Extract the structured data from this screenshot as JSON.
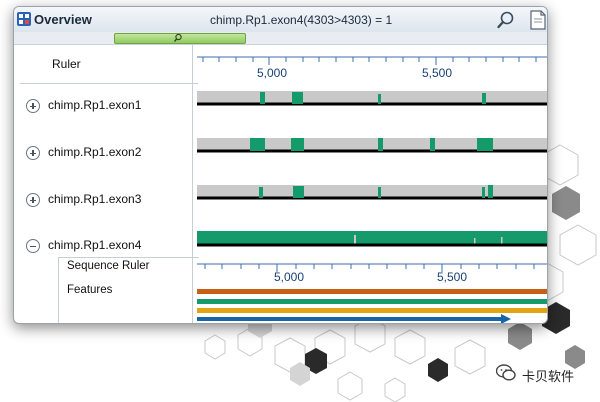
{
  "window": {
    "panel_title": "Overview",
    "view_title": "chimp.Rp1.exon4(4303>4303) = 1"
  },
  "icons": {
    "app": "grid-app-icon",
    "search": "magnifier-icon",
    "document": "document-icon",
    "overview_thumb": "magnifier-icon",
    "expand": "plus-icon",
    "collapse": "minus-icon",
    "watermark": "wechat-icon"
  },
  "ruler": {
    "label": "Ruler",
    "ticks": [
      "5,000",
      "5,500"
    ]
  },
  "tracks": [
    {
      "label": "chimp.Rp1.exon1",
      "state": "collapsed"
    },
    {
      "label": "chimp.Rp1.exon2",
      "state": "collapsed"
    },
    {
      "label": "chimp.Rp1.exon3",
      "state": "collapsed"
    },
    {
      "label": "chimp.Rp1.exon4",
      "state": "expanded"
    }
  ],
  "expanded_panel": {
    "items": [
      "Sequence Ruler",
      "Features"
    ],
    "ruler_ticks": [
      "5,000",
      "5,500"
    ]
  },
  "colors": {
    "coverage": "#159a6c",
    "track_gray": "#c9c9c9",
    "feature_orange": "#c95f14",
    "feature_teal": "#159a6c",
    "feature_gold": "#e2a414",
    "feature_arrow": "#1565a8"
  },
  "watermark": {
    "text": "卡贝软件"
  }
}
